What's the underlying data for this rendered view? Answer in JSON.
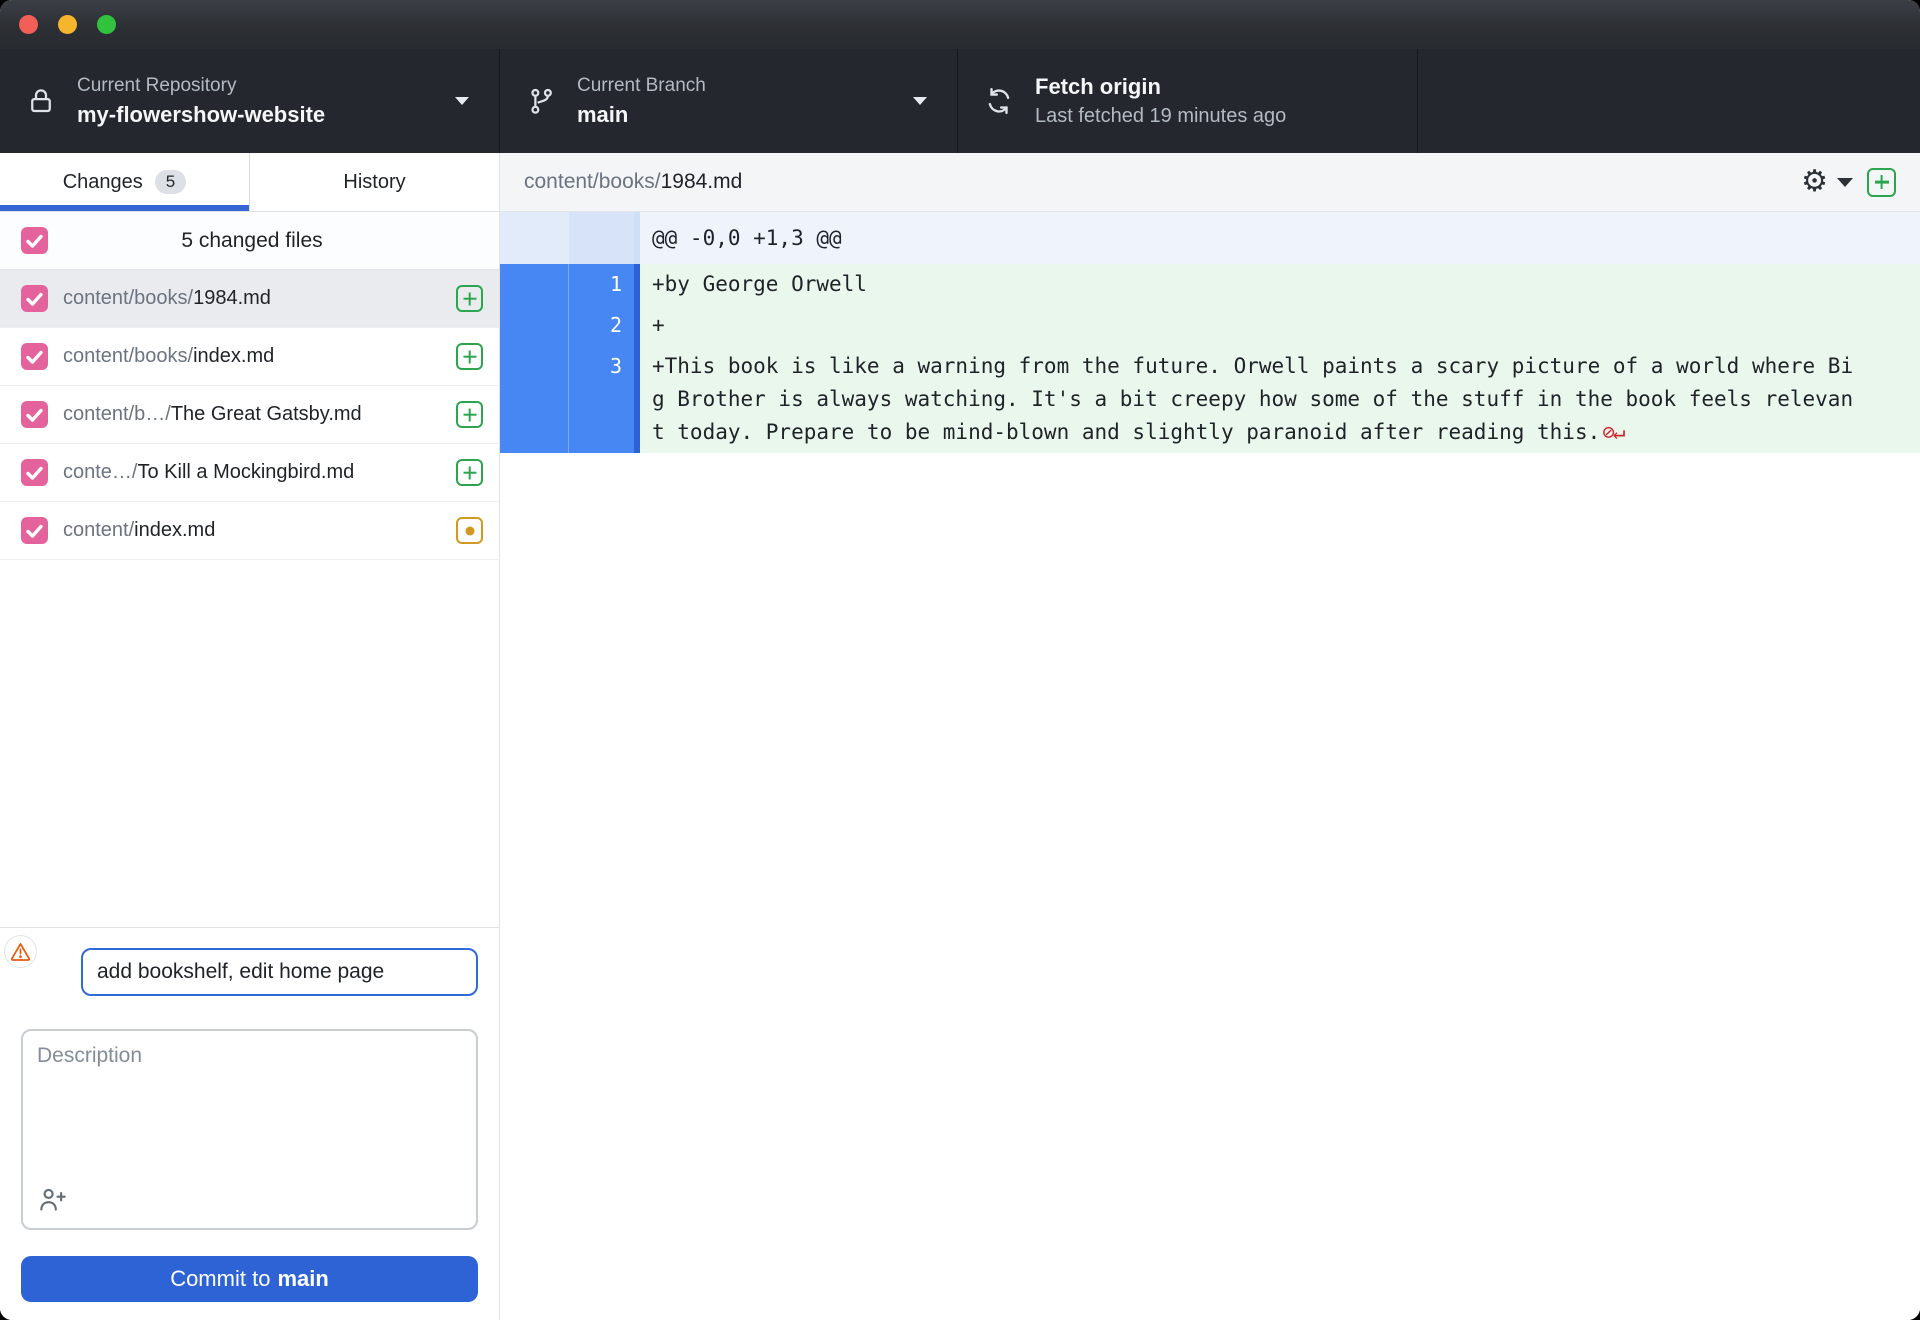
{
  "window": {
    "controls": [
      "close",
      "minimize",
      "zoom"
    ]
  },
  "toolbar": {
    "repository": {
      "label": "Current Repository",
      "value": "my-flowershow-website"
    },
    "branch": {
      "label": "Current Branch",
      "value": "main"
    },
    "fetch": {
      "title": "Fetch origin",
      "subtitle": "Last fetched 19 minutes ago"
    }
  },
  "sidebar": {
    "tabs": [
      {
        "label": "Changes",
        "badge": "5",
        "active": true
      },
      {
        "label": "History",
        "active": false
      }
    ],
    "files_header": {
      "label": "5 changed files",
      "checked": true
    },
    "files": [
      {
        "dir": "content/books/",
        "name": "1984.md",
        "status": "added",
        "checked": true,
        "selected": true
      },
      {
        "dir": "content/books/",
        "name": "index.md",
        "status": "added",
        "checked": true
      },
      {
        "dir": "content/b…/",
        "name": "The Great Gatsby.md",
        "status": "added",
        "checked": true
      },
      {
        "dir": "conte…/",
        "name": "To Kill a Mockingbird.md",
        "status": "added",
        "checked": true
      },
      {
        "dir": "content/",
        "name": "index.md",
        "status": "modified",
        "checked": true
      }
    ],
    "commit": {
      "summary_value": "add bookshelf, edit home page",
      "description_placeholder": "Description",
      "button_prefix": "Commit to",
      "button_branch": "main"
    }
  },
  "diff": {
    "file": {
      "dir": "content/books/",
      "name": "1984.md"
    },
    "hunk_header": "@@ -0,0 +1,3 @@",
    "lines": [
      {
        "new_number": "1",
        "text": "+by George Orwell"
      },
      {
        "new_number": "2",
        "text": "+"
      },
      {
        "new_number": "3",
        "text": "+This book is like a warning from the future. Orwell paints a scary picture of a world where Big Brother is always watching. It's a bit creepy how some of the stuff in the book feels relevant today. Prepare to be mind-blown and slightly paranoid after reading this.",
        "no_newline": true
      }
    ]
  },
  "icons": {
    "no_newline": "⊘↵",
    "gear": "⚙"
  },
  "colors": {
    "checkbox_pink": "#e4639c",
    "commit_button_blue": "#2e63d6",
    "tab_underline_blue": "#3566d3",
    "added_green": "#2da44e",
    "modified_yellow": "#d29922",
    "selected_gutter_blue": "#4787f3",
    "added_line_bg": "#e9f7ec",
    "hunk_header_bg": "#eef3fc",
    "no_newline_red": "#d1242f",
    "warning_orange": "#e8590c",
    "toolbar_bg": "#24282e",
    "traffic_red": "#f35f57",
    "traffic_yellow": "#f5b62e",
    "traffic_green": "#31c33e"
  }
}
